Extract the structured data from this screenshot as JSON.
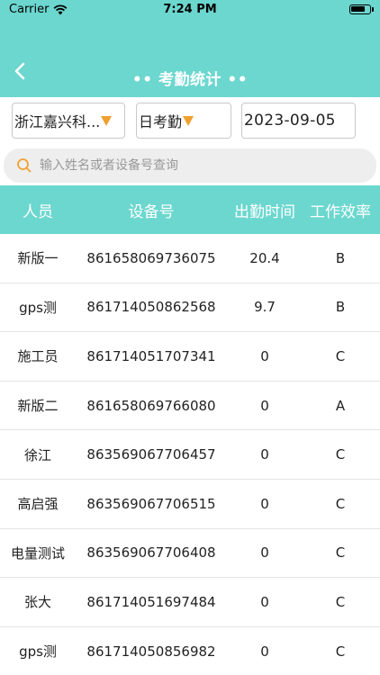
{
  "status_bar": {
    "carrier": "Carrier",
    "time": "7:24 PM"
  },
  "nav": {
    "title": "•• 考勤统计 ••"
  },
  "filters": {
    "company": "浙江嘉兴科...",
    "mode": "日考勤",
    "date": "2023-09-05"
  },
  "search": {
    "placeholder": "输入姓名或者设备号查询"
  },
  "table": {
    "headers": [
      "人员",
      "设备号",
      "出勤时间",
      "工作效率"
    ],
    "rows": [
      {
        "name": "新版一",
        "device": "861658069736075",
        "hours": "20.4",
        "efficiency": "B"
      },
      {
        "name": "gps测",
        "device": "861714050862568",
        "hours": "9.7",
        "efficiency": "B"
      },
      {
        "name": "施工员",
        "device": "861714051707341",
        "hours": "0",
        "efficiency": "C"
      },
      {
        "name": "新版二",
        "device": "861658069766080",
        "hours": "0",
        "efficiency": "A"
      },
      {
        "name": "徐江",
        "device": "863569067706457",
        "hours": "0",
        "efficiency": "C"
      },
      {
        "name": "高启强",
        "device": "863569067706515",
        "hours": "0",
        "efficiency": "C"
      },
      {
        "name": "电量测试",
        "device": "863569067706408",
        "hours": "0",
        "efficiency": "C"
      },
      {
        "name": "张大",
        "device": "861714051697484",
        "hours": "0",
        "efficiency": "C"
      },
      {
        "name": "gps测",
        "device": "861714050856982",
        "hours": "0",
        "efficiency": "C"
      }
    ]
  },
  "colors": {
    "accent": "#6cd7cf",
    "caret": "#f0a030"
  }
}
